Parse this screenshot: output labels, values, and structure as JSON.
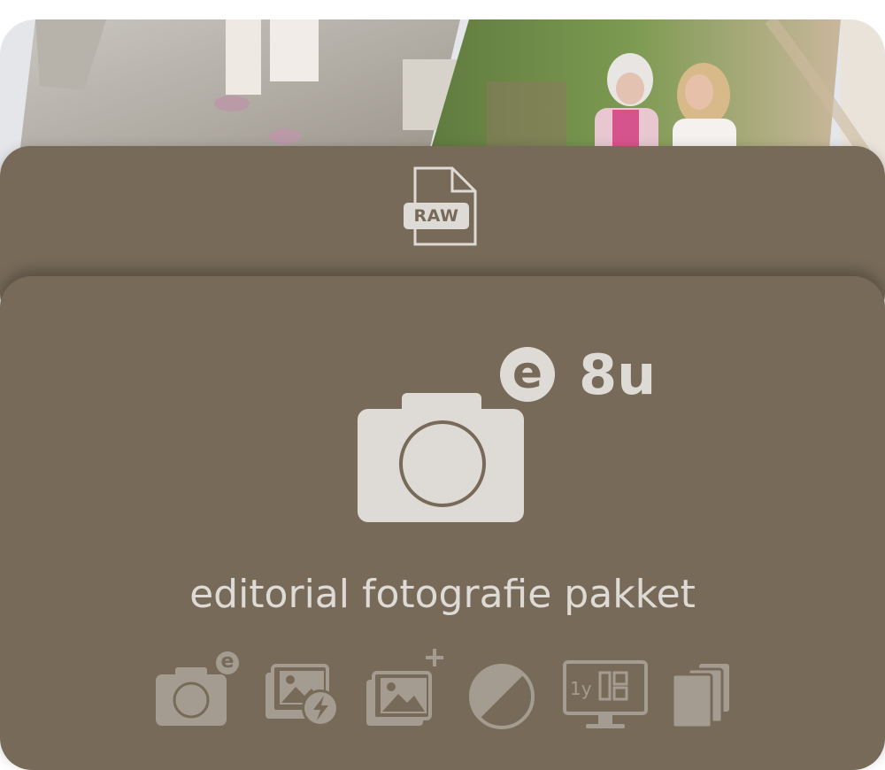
{
  "back_card": {
    "file_format_label": "RAW"
  },
  "main_card": {
    "badge_letter": "e",
    "duration": "8u",
    "title": "editorial fotografie pakket"
  },
  "features": [
    {
      "icon": "editorial-camera-icon",
      "badge": "e"
    },
    {
      "icon": "fast-delivery-photos-icon"
    },
    {
      "icon": "extra-photos-icon",
      "badge": "+"
    },
    {
      "icon": "color-edit-icon"
    },
    {
      "icon": "online-gallery-1-year-icon",
      "label": "1y"
    },
    {
      "icon": "prints-stack-icon"
    }
  ],
  "colors": {
    "card": "#776a58",
    "icon_light": "#dedbd6",
    "icon_muted": "#a49c91"
  }
}
